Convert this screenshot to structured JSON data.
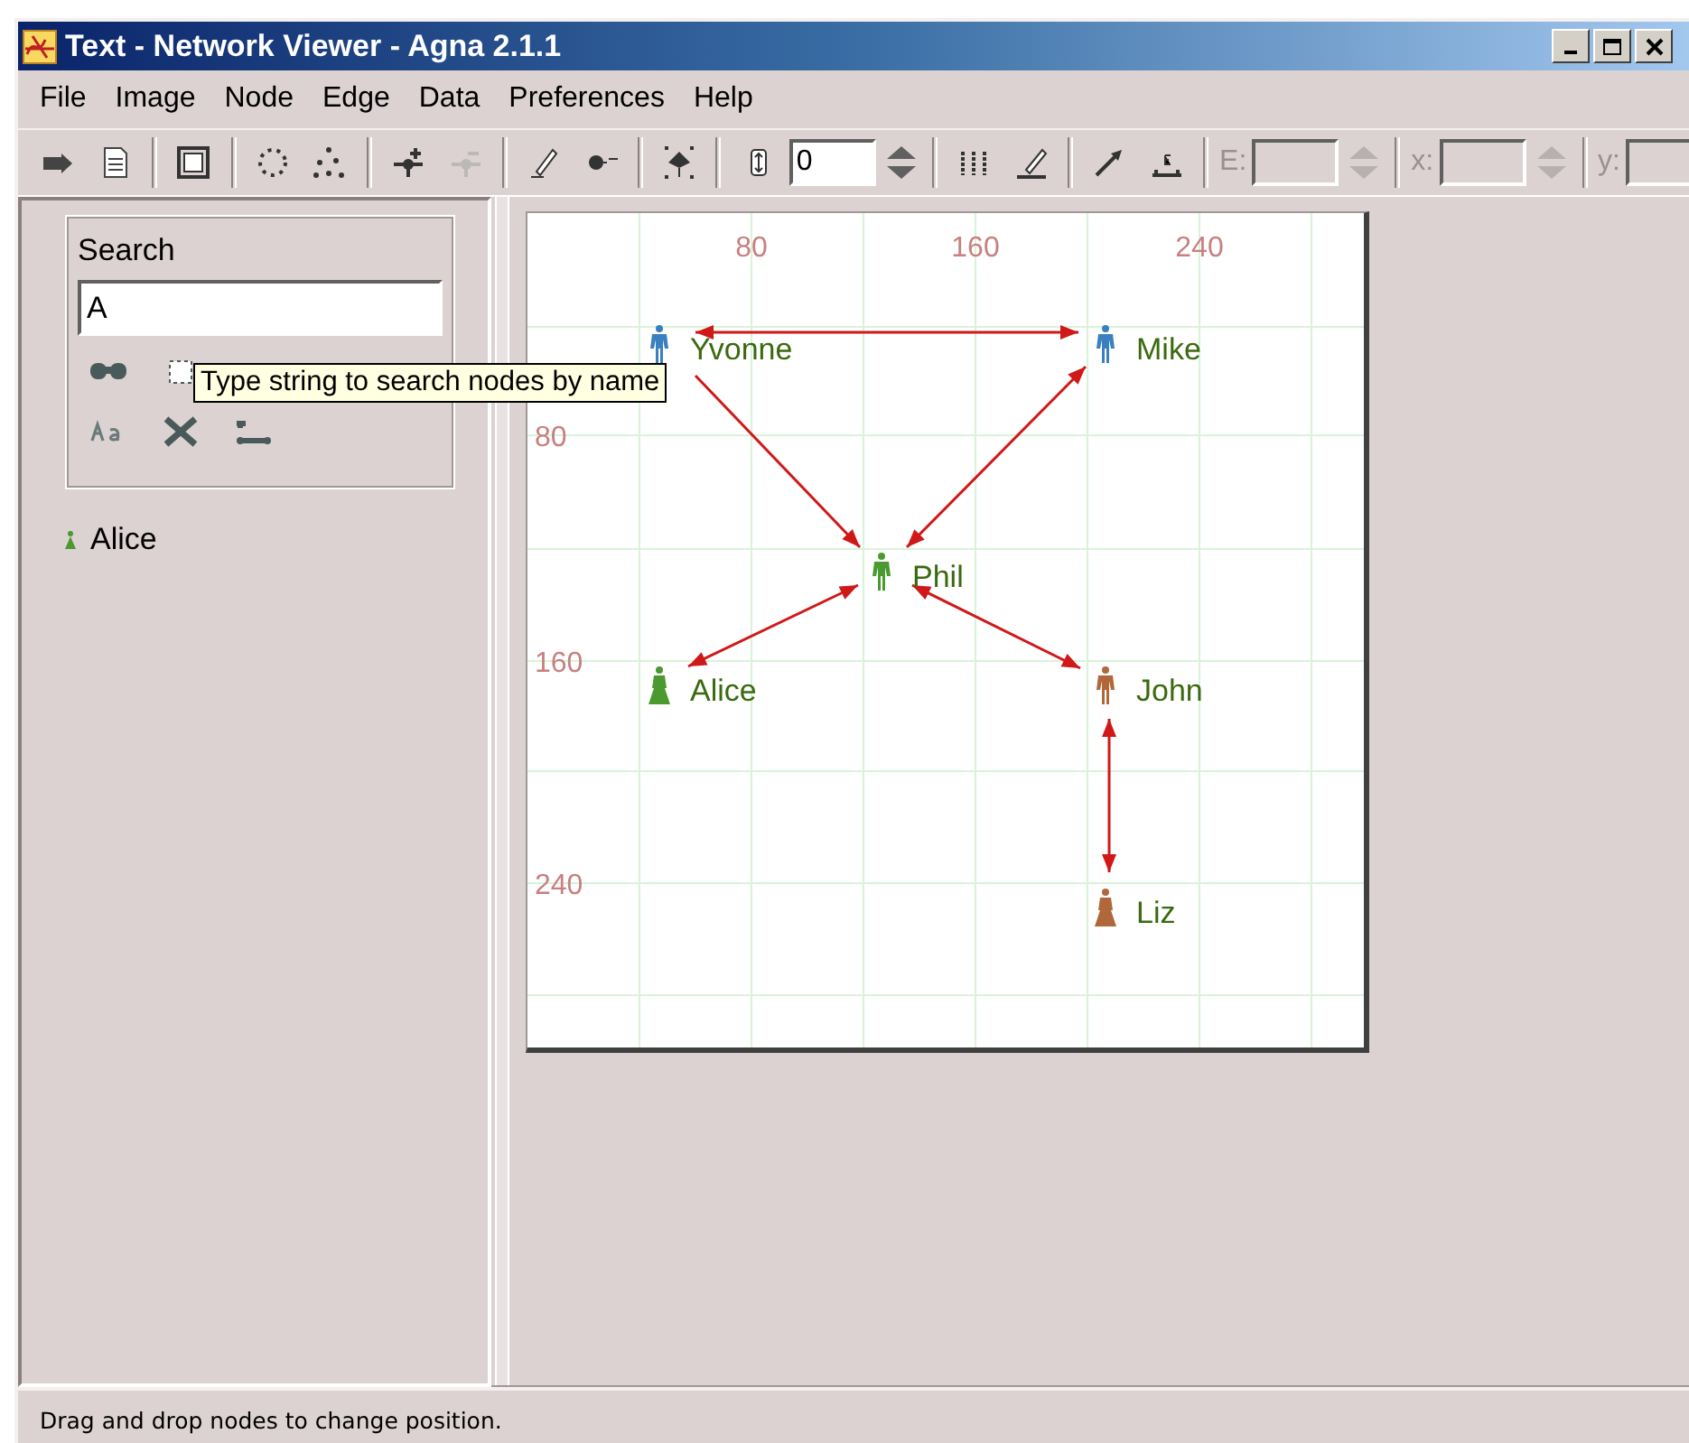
{
  "window": {
    "title": "Text - Network Viewer - Agna 2.1.1"
  },
  "menu": [
    {
      "label": "File"
    },
    {
      "label": "Image"
    },
    {
      "label": "Node"
    },
    {
      "label": "Edge"
    },
    {
      "label": "Data"
    },
    {
      "label": "Preferences"
    },
    {
      "label": "Help"
    }
  ],
  "toolbar": [
    {
      "kind": "button",
      "disabled": false
    },
    {
      "kind": "button",
      "disabled": false
    },
    {
      "kind": "separator"
    },
    {
      "kind": "button",
      "disabled": false
    },
    {
      "kind": "separator"
    },
    {
      "kind": "button",
      "disabled": false
    },
    {
      "kind": "button",
      "disabled": false
    },
    {
      "kind": "separator"
    },
    {
      "kind": "button",
      "disabled": false
    },
    {
      "kind": "button",
      "disabled": true
    },
    {
      "kind": "separator"
    },
    {
      "kind": "button",
      "disabled": false
    },
    {
      "kind": "button",
      "disabled": false
    },
    {
      "kind": "separator"
    },
    {
      "kind": "button",
      "disabled": false
    },
    {
      "kind": "separator"
    },
    {
      "kind": "button",
      "disabled": false
    },
    {
      "kind": "field",
      "value": "0",
      "disabled": false
    },
    {
      "kind": "spinner",
      "disabled": false
    },
    {
      "kind": "separator"
    },
    {
      "kind": "button",
      "disabled": false
    },
    {
      "kind": "button",
      "disabled": false
    },
    {
      "kind": "separator"
    },
    {
      "kind": "button",
      "disabled": false
    },
    {
      "kind": "button",
      "disabled": false
    },
    {
      "kind": "separator"
    },
    {
      "kind": "label",
      "text": "E:",
      "disabled": true
    },
    {
      "kind": "field",
      "disabled": true
    },
    {
      "kind": "spinner",
      "disabled": true
    },
    {
      "kind": "separator"
    },
    {
      "kind": "label",
      "text": "x:",
      "disabled": true
    },
    {
      "kind": "field",
      "disabled": true
    },
    {
      "kind": "spinner",
      "disabled": true
    },
    {
      "kind": "separator"
    },
    {
      "kind": "label",
      "text": "y:",
      "disabled": true
    },
    {
      "kind": "field",
      "disabled": true
    }
  ],
  "search": {
    "title": "Search",
    "query": "A",
    "tooltip": "Type string to search nodes by name",
    "results": [
      {
        "label": "Alice",
        "color": "#4a9a30"
      }
    ]
  },
  "graph": {
    "x_ticks": [
      "80",
      "160",
      "240"
    ],
    "y_ticks": [
      "80",
      "160",
      "240"
    ],
    "nodes": [
      {
        "label": "Yvonne",
        "kind": "male",
        "color": "#3a7fc0"
      },
      {
        "label": "Mike",
        "kind": "male",
        "color": "#3a7fc0"
      },
      {
        "label": "Phil",
        "kind": "male",
        "color": "#4a9a30"
      },
      {
        "label": "Alice",
        "kind": "female",
        "color": "#4a9a30"
      },
      {
        "label": "John",
        "kind": "male",
        "color": "#b0683a"
      },
      {
        "label": "Liz",
        "kind": "female",
        "color": "#b0683a"
      }
    ],
    "edges": [
      {
        "start_arrow": true,
        "end_arrow": true
      },
      {
        "start_arrow": false,
        "end_arrow": true
      },
      {
        "start_arrow": true,
        "end_arrow": true
      },
      {
        "start_arrow": true,
        "end_arrow": true
      },
      {
        "start_arrow": true,
        "end_arrow": true
      },
      {
        "start_arrow": true,
        "end_arrow": true
      }
    ]
  },
  "status_bar": {
    "text": "Drag and drop nodes to change position."
  }
}
